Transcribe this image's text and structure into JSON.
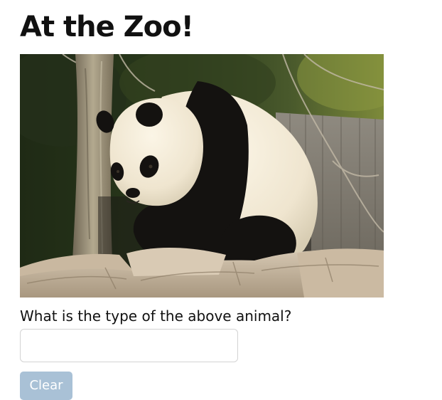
{
  "page": {
    "title": "At the Zoo!"
  },
  "image": {
    "subject": "giant-panda",
    "alt": ""
  },
  "quiz": {
    "question": "What is the type of the above animal?",
    "answer_value": "",
    "answer_placeholder": ""
  },
  "actions": {
    "clear_label": "Clear",
    "clear_disabled": true
  },
  "colors": {
    "title_text": "#111111",
    "input_border": "#d3d3d3",
    "clear_button_bg": "#a9c1d6",
    "clear_button_text": "#ffffff"
  }
}
